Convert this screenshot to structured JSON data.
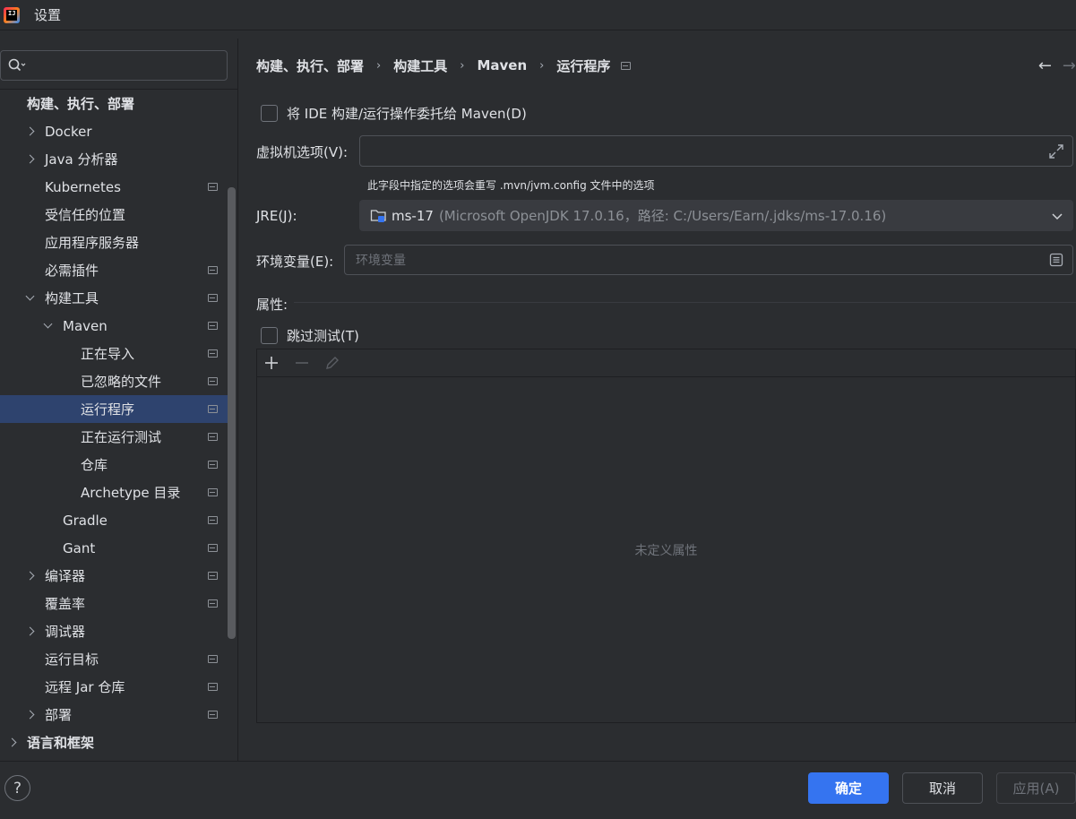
{
  "window": {
    "title": "设置",
    "logo_text": "IJ"
  },
  "search": {
    "value": "",
    "placeholder": ""
  },
  "sidebar": {
    "items": [
      {
        "label": "构建、执行、部署",
        "chevron": "none",
        "icon": false
      },
      {
        "label": "Docker",
        "chevron": "right",
        "icon": false
      },
      {
        "label": "Java 分析器",
        "chevron": "right",
        "icon": false
      },
      {
        "label": "Kubernetes",
        "chevron": "none",
        "icon": true
      },
      {
        "label": "受信任的位置",
        "chevron": "none",
        "icon": false
      },
      {
        "label": "应用程序服务器",
        "chevron": "none",
        "icon": false
      },
      {
        "label": "必需插件",
        "chevron": "none",
        "icon": true
      },
      {
        "label": "构建工具",
        "chevron": "down",
        "icon": true
      },
      {
        "label": "Maven",
        "chevron": "down",
        "icon": true
      },
      {
        "label": "正在导入",
        "chevron": "none",
        "icon": true
      },
      {
        "label": "已忽略的文件",
        "chevron": "none",
        "icon": true
      },
      {
        "label": "运行程序",
        "chevron": "none",
        "icon": true,
        "selected": true
      },
      {
        "label": "正在运行测试",
        "chevron": "none",
        "icon": true
      },
      {
        "label": "仓库",
        "chevron": "none",
        "icon": true
      },
      {
        "label": "Archetype 目录",
        "chevron": "none",
        "icon": true
      },
      {
        "label": "Gradle",
        "chevron": "none",
        "icon": true
      },
      {
        "label": "Gant",
        "chevron": "none",
        "icon": true
      },
      {
        "label": "编译器",
        "chevron": "right",
        "icon": true
      },
      {
        "label": "覆盖率",
        "chevron": "none",
        "icon": true
      },
      {
        "label": "调试器",
        "chevron": "right",
        "icon": false
      },
      {
        "label": "运行目标",
        "chevron": "none",
        "icon": true
      },
      {
        "label": "远程 Jar 仓库",
        "chevron": "none",
        "icon": true
      },
      {
        "label": "部署",
        "chevron": "right",
        "icon": true
      },
      {
        "label": "语言和框架",
        "chevron": "right",
        "icon": false
      }
    ]
  },
  "breadcrumb": {
    "items": [
      "构建、执行、部署",
      "构建工具",
      "Maven",
      "运行程序"
    ],
    "separator": "›"
  },
  "nav": {
    "back": "←",
    "forward": "→"
  },
  "form": {
    "delegate_label": "将 IDE 构建/运行操作委托给 Maven(D)",
    "vm_options_label": "虚拟机选项(V):",
    "vm_options_value": "",
    "vm_options_hint": "此字段中指定的选项会重写 .mvn/jvm.config 文件中的选项",
    "jre_label": "JRE(J):",
    "jre_name": "ms-17",
    "jre_detail": "(Microsoft OpenJDK 17.0.16，路径: C:/Users/Earn/.jdks/ms-17.0.16)",
    "env_label": "环境变量(E):",
    "env_placeholder": "环境变量",
    "properties_title": "属性:",
    "skip_tests_label": "跳过测试(T)",
    "properties_empty": "未定义属性"
  },
  "footer": {
    "help": "?",
    "ok": "确定",
    "cancel": "取消",
    "apply": "应用(A)"
  },
  "colors": {
    "background": "#2b2d30",
    "selection": "#2e436e",
    "primary_button": "#3574f0"
  }
}
